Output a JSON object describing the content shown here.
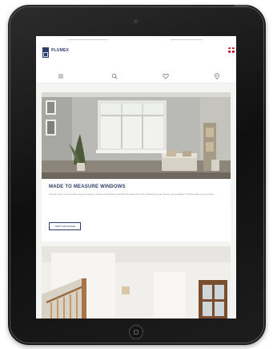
{
  "site": {
    "logo_text": "PLUMEX"
  },
  "nav": {
    "icons": [
      "menu-icon",
      "search-icon",
      "heart-icon",
      "location-icon"
    ]
  },
  "hero": {
    "title": "MADE TO MEASURE WINDOWS",
    "body": "Choose from our extensive range of styles, colours and finishes and find the best fit for the windows in your home. Get a design to fit the style of your home.",
    "cta_label": "VIEW THE RANGE"
  },
  "colors": {
    "brand": "#2b3e6b",
    "flag_red": "#c8202e"
  }
}
